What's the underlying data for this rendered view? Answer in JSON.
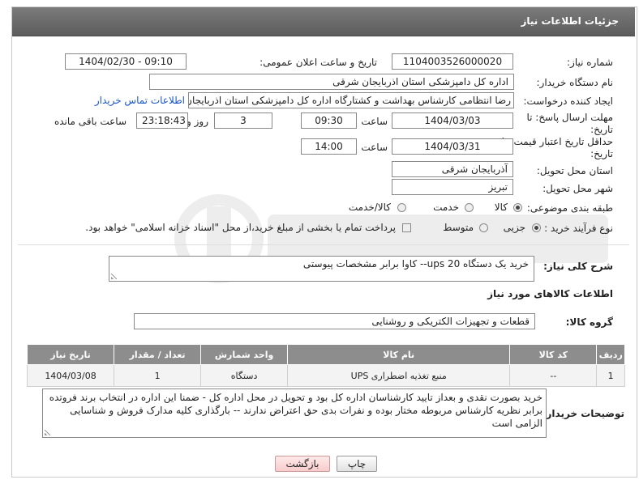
{
  "header": {
    "title": "جزئیات اطلاعات نیاز"
  },
  "fields": {
    "need_number": {
      "label": "شماره نیاز:",
      "value": "1104003526000020"
    },
    "announce_datetime": {
      "label": "تاریخ و ساعت اعلان عمومی:",
      "value": "1404/02/30 - 09:10"
    },
    "buyer_org": {
      "label": "نام دستگاه خریدار:",
      "value": "اداره کل دامپزشکی استان اذربایجان شرقی"
    },
    "requester": {
      "label": "ایجاد کننده درخواست:",
      "value": "رضا انتظامی کارشناس بهداشت و کشتارگاه اداره کل دامپزشکی استان اذربایجان",
      "contact_link": "اطلاعات تماس خریدار"
    },
    "reply_deadline": {
      "label": "مهلت ارسال پاسخ: تا تاریخ:",
      "date": "1404/03/03",
      "time_label": "ساعت",
      "time": "09:30",
      "days": "3",
      "days_label": "روز و",
      "remaining": "23:18:43",
      "remaining_label": "ساعت باقی مانده"
    },
    "price_validity": {
      "label": "حداقل تاریخ اعتبار قیمت: تا تاریخ:",
      "date": "1404/03/31",
      "time_label": "ساعت",
      "time": "14:00"
    },
    "delivery_province": {
      "label": "استان محل تحویل:",
      "value": "آذربایجان شرقی"
    },
    "delivery_city": {
      "label": "شهر محل تحویل:",
      "value": "تبریز"
    },
    "category": {
      "label": "طبقه بندی موضوعی:",
      "options": [
        "کالا",
        "خدمت",
        "کالا/خدمت"
      ],
      "selected": "کالا"
    },
    "purchase_type": {
      "label": "نوع فرآیند خرید :",
      "options": [
        "جزیی",
        "متوسط"
      ],
      "selected": "جزیی",
      "payment_note": "پرداخت تمام یا بخشی از مبلغ خرید،از محل \"اسناد خزانه اسلامی\" خواهد بود."
    }
  },
  "description": {
    "label": "شرح کلی نیاز:",
    "value": "خرید یک دستگاه ups 20-- کاوا برابر مشخصات پیوستی"
  },
  "goods_section": {
    "title": "اطلاعات کالاهای مورد نیاز",
    "group_label": "گروه کالا:",
    "group_value": "قطعات و تجهیزات الکتریکی و روشنایی"
  },
  "items_table": {
    "headers": [
      "ردیف",
      "کد کالا",
      "نام کالا",
      "واحد شمارش",
      "تعداد / مقدار",
      "تاریخ نیاز"
    ],
    "rows": [
      [
        "1",
        "--",
        "منبع تغذیه اضطراری UPS",
        "دستگاه",
        "1",
        "1404/03/08"
      ]
    ]
  },
  "buyer_notes": {
    "label": "توضیحات خریدار:",
    "value": "خرید بصورت نقدی و بعداز تایید کارشناسان اداره کل بود و تحویل در محل اداره کل - ضمنا این اداره  در انتخاب برند فروتده برابر نظریه کارشناس مربوطه مختار بوده و نفرات بدی حق اعتراض ندارند -- بارگذاری کلیه مدارک فروش و شناسایی الزامی است"
  },
  "buttons": {
    "print": "چاپ",
    "back": "بازگشت"
  }
}
